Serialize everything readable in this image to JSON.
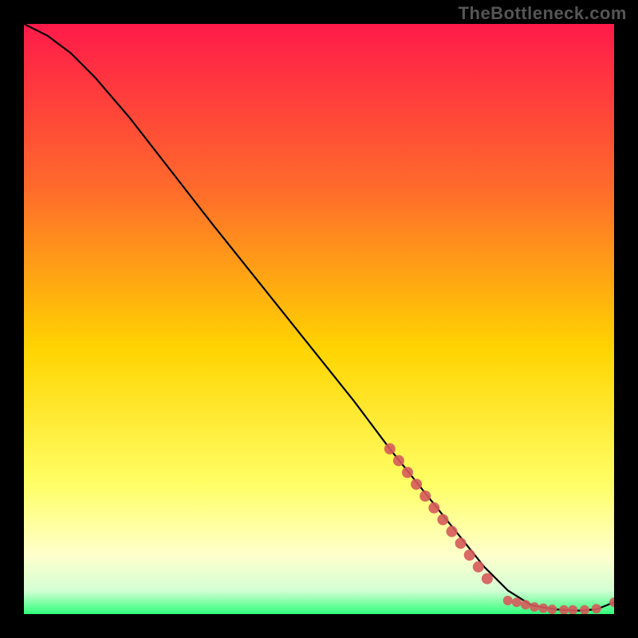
{
  "watermark": "TheBottleneck.com",
  "colors": {
    "background": "#000000",
    "gradient_top": "#ff1a4a",
    "gradient_mid_upper": "#ff6b2b",
    "gradient_mid": "#ffd400",
    "gradient_mid_lower": "#ffff66",
    "gradient_low": "#ffffcc",
    "gradient_bottom": "#2fff7a",
    "line": "#000000",
    "marker": "#d65a5a"
  },
  "chart_data": {
    "type": "line",
    "title": "",
    "xlabel": "",
    "ylabel": "",
    "xlim": [
      0,
      100
    ],
    "ylim": [
      0,
      100
    ],
    "grid": false,
    "series": [
      {
        "name": "curve",
        "x": [
          0,
          4,
          8,
          12,
          18,
          25,
          32,
          40,
          48,
          56,
          62,
          66,
          70,
          74,
          78,
          82,
          86,
          90,
          94,
          97,
          100
        ],
        "y": [
          100,
          98,
          95,
          91,
          84,
          75,
          66,
          56,
          46,
          36,
          28,
          23,
          18,
          13,
          8,
          4,
          1.5,
          0.8,
          0.6,
          0.8,
          2
        ]
      },
      {
        "name": "markers-cluster",
        "x": [
          62,
          63.5,
          65,
          66.5,
          68,
          69.5,
          71,
          72.5,
          74,
          75.5,
          77,
          78.5
        ],
        "y": [
          28,
          26,
          24,
          22,
          20,
          18,
          16,
          14,
          12,
          10,
          8,
          6
        ]
      },
      {
        "name": "markers-flat",
        "x": [
          82,
          83.5,
          85,
          86.5,
          88,
          89.5,
          91.5,
          93,
          95,
          97,
          100
        ],
        "y": [
          2.3,
          2.0,
          1.6,
          1.2,
          1.0,
          0.8,
          0.7,
          0.7,
          0.7,
          0.9,
          2.0
        ]
      }
    ]
  }
}
